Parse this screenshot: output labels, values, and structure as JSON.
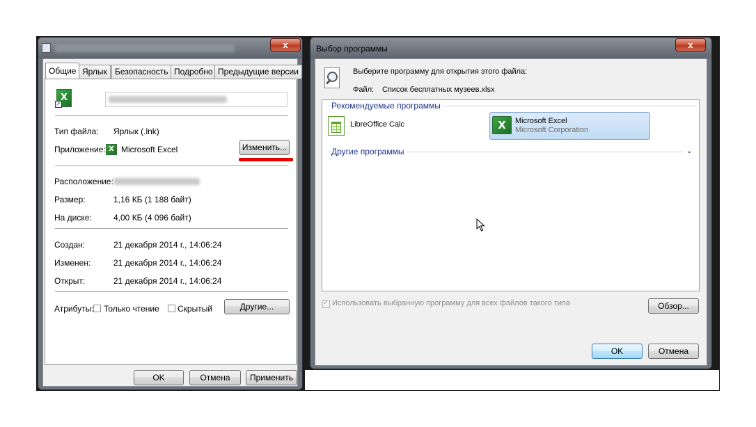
{
  "props": {
    "tabs": [
      "Общие",
      "Ярлык",
      "Безопасность",
      "Подробно",
      "Предыдущие версии"
    ],
    "filetype_label": "Тип файла:",
    "filetype_value": "Ярлык (.lnk)",
    "app_label": "Приложение:",
    "app_value": "Microsoft Excel",
    "change_button": "Изменить...",
    "location_label": "Расположение:",
    "size_label": "Размер:",
    "size_value": "1,16 КБ (1 188 байт)",
    "disk_label": "На диске:",
    "disk_value": "4,00 КБ (4 096 байт)",
    "created_label": "Создан:",
    "created_value": "21 декабря 2014 г., 14:06:24",
    "modified_label": "Изменен:",
    "modified_value": "21 декабря 2014 г., 14:06:24",
    "opened_label": "Открыт:",
    "opened_value": "21 декабря 2014 г., 14:06:24",
    "attributes_label": "Атрибуты:",
    "readonly_label": "Только чтение",
    "hidden_label": "Скрытый",
    "other_button": "Другие...",
    "ok_button": "OK",
    "cancel_button": "Отмена",
    "apply_button": "Применить",
    "close_glyph": "x"
  },
  "chooser": {
    "title": "Выбор программы",
    "prompt": "Выберите программу для открытия этого файла:",
    "file_label": "Файл:",
    "file_name": "Список бесплатных музеев.xlsx",
    "recommended_title": "Рекомендуемые программы",
    "programs": [
      {
        "name": "LibreOffice Calc",
        "publisher": ""
      },
      {
        "name": "Microsoft Excel",
        "publisher": "Microsoft Corporation"
      }
    ],
    "other_title": "Другие программы",
    "always_use_label": "Использовать выбранную программу для всех файлов такого типа",
    "browse_button": "Обзор...",
    "ok_button": "OK",
    "cancel_button": "Отмена",
    "close_glyph": "x"
  },
  "colors": {
    "accent_underline": "#e60000",
    "group_title": "#1e3287",
    "selected_item": "#cde8f7"
  },
  "icons": [
    "excel-shortcut-icon",
    "excel-icon",
    "libreoffice-calc-icon",
    "magnifier-icon",
    "chevron-down-icon",
    "close-icon",
    "mouse-cursor-icon"
  ]
}
